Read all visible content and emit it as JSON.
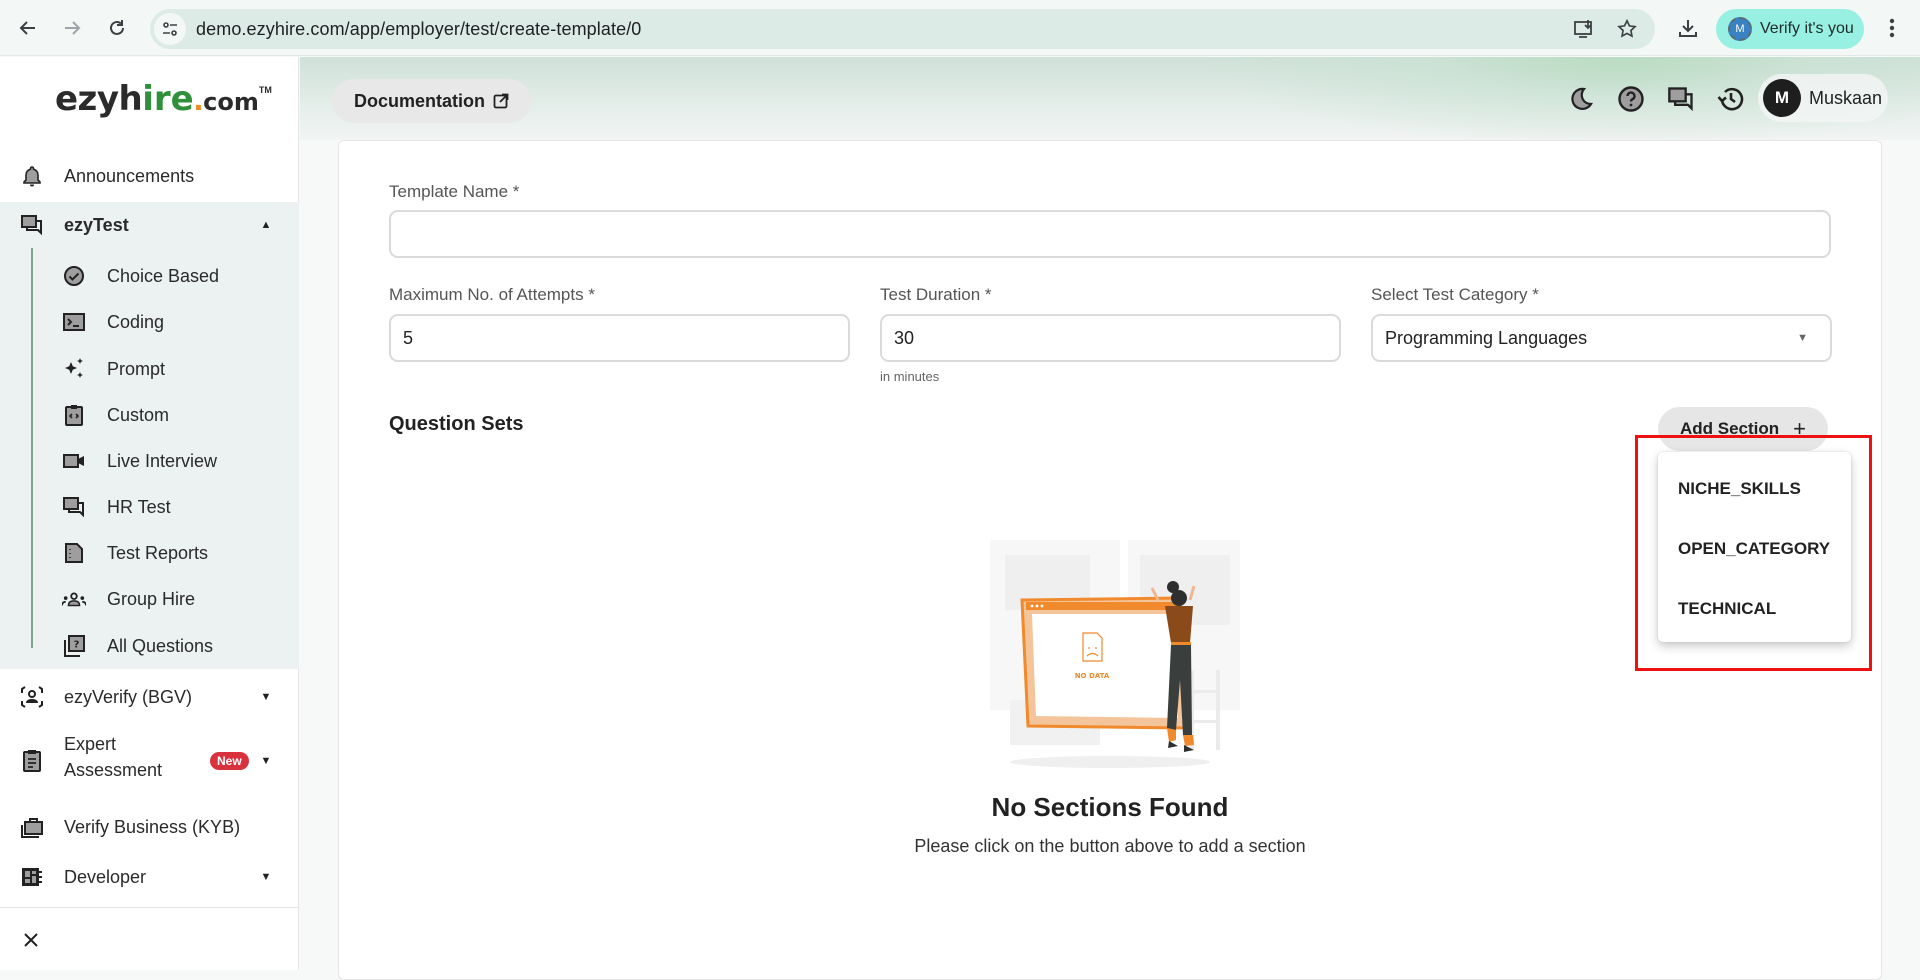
{
  "browser": {
    "url": "demo.ezyhire.com/app/employer/test/create-template/0",
    "profile_button": "Verify it's you",
    "profile_initial": "M",
    "icons": [
      "back-icon",
      "forward-icon",
      "reload-icon",
      "site-info-icon",
      "install-app-icon",
      "bookmark-star-icon",
      "download-icon",
      "more-menu-icon"
    ]
  },
  "logo": {
    "part1": "ezyh",
    "part2": "ire",
    "dot": ".",
    "part3": "com",
    "tm": "TM",
    "colors": {
      "dark": "#2b2b2b",
      "green": "#2f8f3a",
      "orange": "#f08a24"
    }
  },
  "sidebar": {
    "items": [
      {
        "label": "Announcements",
        "icon": "bell-icon"
      },
      {
        "label": "ezyTest",
        "icon": "forum-icon",
        "expanded": true,
        "children": [
          {
            "label": "Choice Based",
            "icon": "check-circle-icon"
          },
          {
            "label": "Coding",
            "icon": "terminal-icon"
          },
          {
            "label": "Prompt",
            "icon": "sparkle-icon"
          },
          {
            "label": "Custom",
            "icon": "code-clipboard-icon"
          },
          {
            "label": "Live Interview",
            "icon": "video-camera-icon"
          },
          {
            "label": "HR Test",
            "icon": "chat-icon"
          },
          {
            "label": "Test Reports",
            "icon": "report-icon"
          },
          {
            "label": "Group Hire",
            "icon": "group-icon"
          },
          {
            "label": "All Questions",
            "icon": "question-library-icon"
          }
        ]
      },
      {
        "label": "ezyVerify (BGV)",
        "icon": "face-scan-icon"
      },
      {
        "label_line1": "Expert",
        "label_line2": "Assessment",
        "icon": "clipboard-icon",
        "badge": "New"
      },
      {
        "label": "Verify Business (KYB)",
        "icon": "briefcase-icon"
      },
      {
        "label": "Developer",
        "icon": "developer-board-icon"
      }
    ],
    "close_icon": "close-icon"
  },
  "header": {
    "documentation_label": "Documentation",
    "icons": [
      "dark-mode-icon",
      "help-icon",
      "feedback-chat-icon",
      "history-icon"
    ],
    "user": {
      "initial": "M",
      "name": "Muskaan"
    }
  },
  "form": {
    "template_name": {
      "label": "Template Name *",
      "value": ""
    },
    "max_attempts": {
      "label": "Maximum No. of Attempts *",
      "value": "5"
    },
    "test_duration": {
      "label": "Test Duration *",
      "value": "30",
      "helper": "in minutes"
    },
    "test_category": {
      "label": "Select Test Category *",
      "value": "Programming Languages"
    }
  },
  "question_sets": {
    "title": "Question Sets",
    "add_section_label": "Add Section",
    "add_section_icon": "+",
    "menu_options": [
      "NICHE_SKILLS",
      "OPEN_CATEGORY",
      "TECHNICAL"
    ],
    "empty_state": {
      "illustration_text": "NO DATA",
      "title": "No Sections Found",
      "subtitle": "Please click on the button above to add a section"
    }
  },
  "colors": {
    "accent_green_line": "#7fa48e",
    "badge_red": "#d8323f",
    "highlight_red": "#ee1111",
    "illustration_orange": "#f08a2c"
  }
}
